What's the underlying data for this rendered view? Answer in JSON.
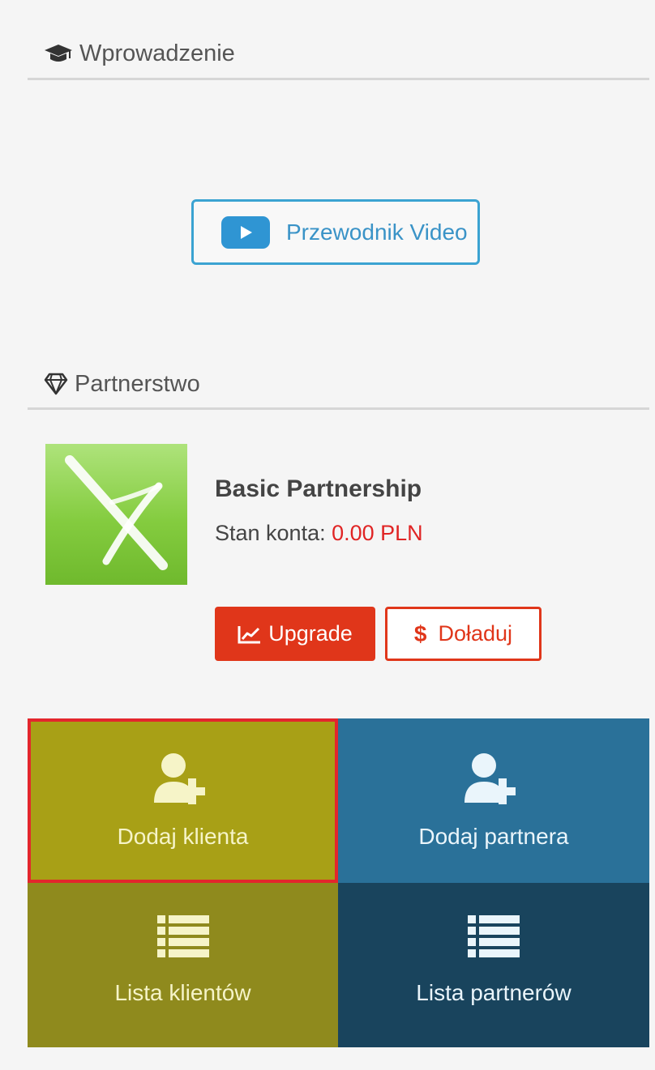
{
  "intro": {
    "title": "Wprowadzenie",
    "icon": "graduation-cap-icon",
    "video_button_label": "Przewodnik Video",
    "video_icon": "youtube-play-icon"
  },
  "partnership": {
    "title": "Partnerstwo",
    "icon": "diamond-icon",
    "plan_name": "Basic Partnership",
    "balance_label": "Stan konta: ",
    "balance_value": "0.00 PLN",
    "upgrade_label": "Upgrade",
    "topup_symbol": "$",
    "topup_label": "Doładuj"
  },
  "tiles": {
    "add_client": "Dodaj klienta",
    "add_partner": "Dodaj partnera",
    "client_list": "Lista klientów",
    "partner_list": "Lista partnerów"
  },
  "colors": {
    "accent_blue": "#3ba3d2",
    "danger_red": "#e0361a",
    "balance_red": "#e02424",
    "tile_olive": "#a8a016",
    "tile_blue": "#2a7199",
    "tile_dark_olive": "#8f8a1d",
    "tile_navy": "#19445d",
    "highlight_border": "#e3262c"
  }
}
